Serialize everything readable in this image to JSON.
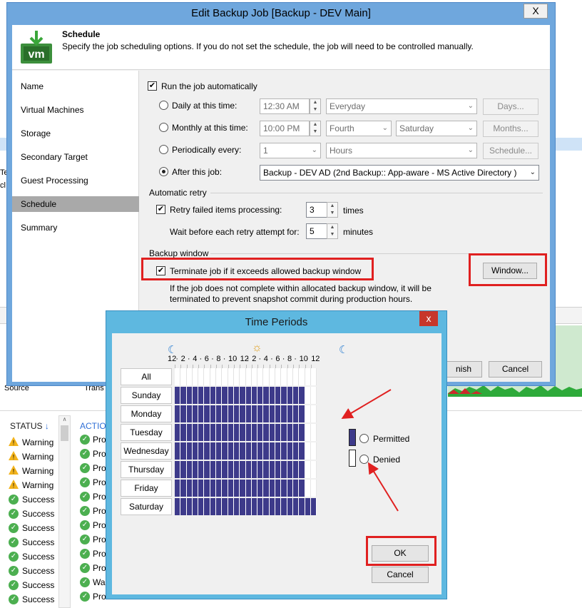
{
  "background": {
    "status_header": "STATUS",
    "action_header": "ACTION",
    "col_source": "Source",
    "col_trans": "Trans",
    "side_text_1": "Te",
    "side_text_2": "cl",
    "status_rows": [
      {
        "icon": "warning-icon",
        "label": "Warning",
        "action": "Pro"
      },
      {
        "icon": "warning-icon",
        "label": "Warning",
        "action": "Pro"
      },
      {
        "icon": "warning-icon",
        "label": "Warning",
        "action": "Pro"
      },
      {
        "icon": "warning-icon",
        "label": "Warning",
        "action": "Pro"
      },
      {
        "icon": "success-icon",
        "label": "Success",
        "action": "Pro"
      },
      {
        "icon": "success-icon",
        "label": "Success",
        "action": "Pro"
      },
      {
        "icon": "success-icon",
        "label": "Success",
        "action": "Pro"
      },
      {
        "icon": "success-icon",
        "label": "Success",
        "action": "Pro"
      },
      {
        "icon": "success-icon",
        "label": "Success",
        "action": "Pro"
      },
      {
        "icon": "success-icon",
        "label": "Success",
        "action": "Pro"
      },
      {
        "icon": "success-icon",
        "label": "Success",
        "action": "Wa"
      },
      {
        "icon": "success-icon",
        "label": "Success",
        "action": "Pro"
      }
    ]
  },
  "dialog": {
    "title": "Edit Backup Job [Backup - DEV Main]",
    "close": "X",
    "header_title": "Schedule",
    "header_desc": "Specify the job scheduling options. If you do not set the schedule, the job will need to be controlled manually.",
    "nav": [
      "Name",
      "Virtual Machines",
      "Storage",
      "Secondary Target",
      "Guest Processing",
      "Schedule",
      "Summary"
    ],
    "run_auto": "Run the job automatically",
    "daily_label": "Daily at this time:",
    "daily_time": "12:30 AM",
    "daily_days": "Everyday",
    "days_btn": "Days...",
    "monthly_label": "Monthly at this time:",
    "monthly_time": "10:00 PM",
    "monthly_week": "Fourth",
    "monthly_day": "Saturday",
    "months_btn": "Months...",
    "periodic_label": "Periodically every:",
    "periodic_value": "1",
    "periodic_unit": "Hours",
    "schedule_btn": "Schedule...",
    "after_label": "After this job:",
    "after_value": "Backup - DEV AD (2nd Backup:: App-aware - MS Active Directory )",
    "retry_group": "Automatic retry",
    "retry_label": "Retry failed items processing:",
    "retry_value": "3",
    "retry_unit": "times",
    "wait_label": "Wait before each retry attempt for:",
    "wait_value": "5",
    "wait_unit": "minutes",
    "window_group": "Backup window",
    "terminate_label": "Terminate job if it exceeds allowed backup window",
    "window_btn": "Window...",
    "terminate_note_1": "If the job does not complete within allocated backup window, it will be",
    "terminate_note_2": "terminated to prevent snapshot commit during production hours.",
    "finish_btn": "nish",
    "cancel_btn": "Cancel"
  },
  "time_periods": {
    "title": "Time Periods",
    "close": "x",
    "hour_labels": [
      "12",
      "2",
      "4",
      "6",
      "8",
      "10",
      "12",
      "2",
      "4",
      "6",
      "8",
      "10",
      "12"
    ],
    "all_label": "All",
    "days": [
      "Sunday",
      "Monday",
      "Tuesday",
      "Wednesday",
      "Thursday",
      "Friday",
      "Saturday"
    ],
    "permitted_hours": 22,
    "saturday_permitted_hours": 24,
    "legend_permitted": "Permitted",
    "legend_denied": "Denied",
    "ok_btn": "OK",
    "cancel_btn": "Cancel",
    "permitted_color": "#3d3a8a",
    "highlight_color": "#e02020"
  }
}
